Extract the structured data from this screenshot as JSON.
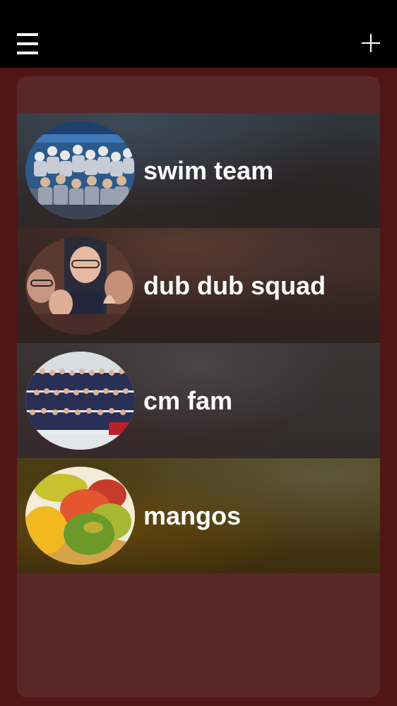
{
  "header": {
    "menu_icon": "hamburger-menu-icon",
    "add_icon": "plus-icon"
  },
  "groups": [
    {
      "name": "swim team",
      "avatar": "swim-team-photo"
    },
    {
      "name": "dub dub squad",
      "avatar": "dub-dub-squad-photo"
    },
    {
      "name": "cm fam",
      "avatar": "cm-fam-photo"
    },
    {
      "name": "mangos",
      "avatar": "mangos-photo"
    }
  ],
  "colors": {
    "topbar": "#000000",
    "background": "#521515",
    "panel": "#5a2828",
    "text": "#ffffff"
  }
}
